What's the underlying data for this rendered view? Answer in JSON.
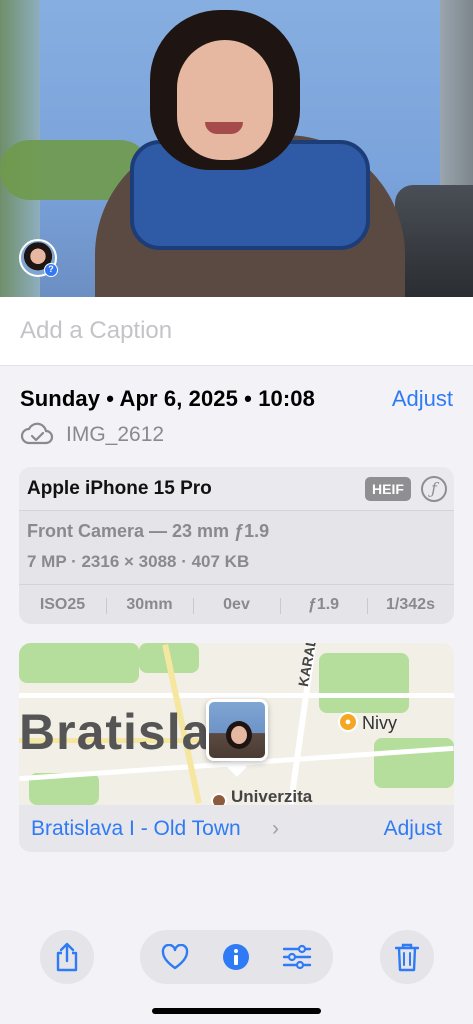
{
  "photo": {
    "avatar_badge": "?"
  },
  "caption": {
    "placeholder": "Add a Caption"
  },
  "info": {
    "date_time": "Sunday • Apr 6, 2025 • 10:08",
    "adjust_label": "Adjust",
    "filename": "IMG_2612",
    "cloud_icon": "cloud-check-icon"
  },
  "camera": {
    "model": "Apple iPhone 15 Pro",
    "format_badge": "HEIF",
    "format_icon": "ƒ",
    "lens": "Front Camera — 23 mm ƒ1.9",
    "resolution": "7 MP · 2316 × 3088 · 407 KB",
    "stats": [
      "ISO25",
      "30mm",
      "0ev",
      "ƒ1.9",
      "1/342s"
    ]
  },
  "map": {
    "city_label": "Bratislava",
    "street_label": "KARADŽIČO",
    "poi_nivy": "Nivy",
    "poi_univ": "Univerzita",
    "location_link": "Bratislava I - Old Town",
    "location_chevron": "›",
    "adjust_label": "Adjust"
  },
  "toolbar": {
    "share": "share-icon",
    "favorite": "heart-icon",
    "info": "info-icon",
    "edit": "sliders-icon",
    "delete": "trash-icon"
  },
  "colors": {
    "accent": "#2f7bf5",
    "secondary_text": "#8a8a8e",
    "card_bg": "#e4e4e9"
  }
}
